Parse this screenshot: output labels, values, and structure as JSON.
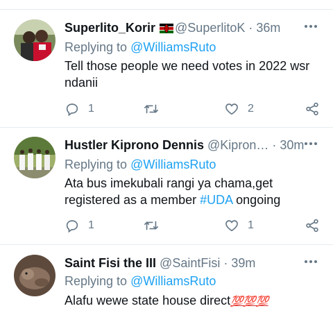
{
  "tweets": [
    {
      "name": "Superlito_Korir",
      "handle": "@SuperlitoK",
      "time": "36m",
      "has_flag": true,
      "replying_prefix": "Replying to",
      "replying_to": "@WilliamsRuto",
      "text": "Tell those people we need votes in 2022 wsr ndanii",
      "replies": "1",
      "retweets": "",
      "likes": "2"
    },
    {
      "name": "Hustler Kiprono Dennis",
      "handle": "@Kipron…",
      "time": "30m",
      "replying_prefix": "Replying to",
      "replying_to": "@WilliamsRuto",
      "text_part1": "Ata bus imekubali rangi ya chama,get registered as a member",
      "hashtag": "#UDA",
      "text_part2": "ongoing",
      "replies": "1",
      "retweets": "",
      "likes": "1"
    },
    {
      "name": "Saint Fisi the III",
      "handle": "@SaintFisi",
      "time": "39m",
      "replying_prefix": "Replying to",
      "replying_to": "@WilliamsRuto",
      "text": "Alafu wewe state house direct",
      "emoji": "💯💯💯"
    }
  ],
  "separator": "·",
  "icons": {
    "reply": "reply-icon",
    "retweet": "retweet-icon",
    "like": "heart-icon",
    "share": "share-icon",
    "more": "more-icon",
    "flag": "kenya-flag-icon"
  },
  "colors": {
    "link": "#1da1f2",
    "muted": "#657786",
    "text": "#0f1419",
    "divider": "#e6ecf0"
  }
}
